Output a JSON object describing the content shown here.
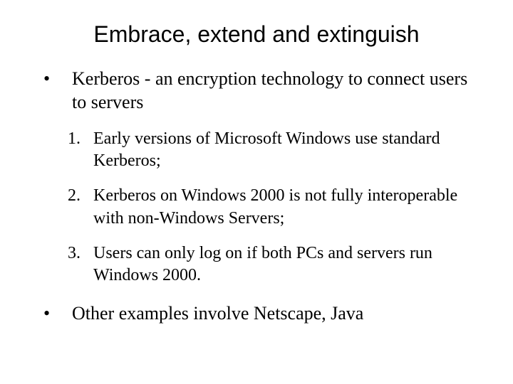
{
  "title": "Embrace, extend and extinguish",
  "bullets": [
    {
      "text": "Kerberos - an encryption technology to connect users to servers"
    },
    {
      "text": "Other examples involve Netscape, Java"
    }
  ],
  "numbered": [
    {
      "marker": "1.",
      "text": "Early versions of Microsoft Windows use standard Kerberos;"
    },
    {
      "marker": "2.",
      "text": "Kerberos on Windows 2000 is not fully interoperable with non-Windows Servers;"
    },
    {
      "marker": "3.",
      "text": "Users can only log on if both PCs and servers run Windows 2000."
    }
  ]
}
